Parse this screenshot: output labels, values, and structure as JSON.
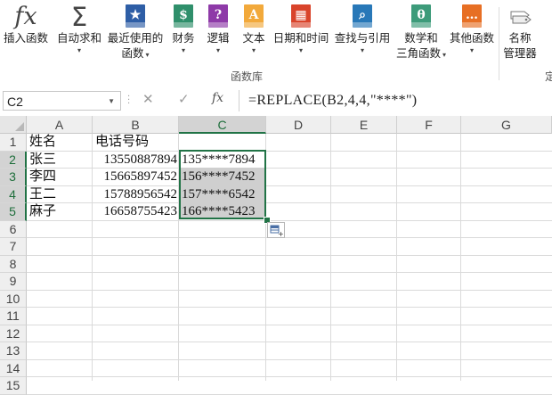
{
  "ribbon": {
    "buttons": [
      {
        "id": "insert-function",
        "label": "插入函数",
        "label2": "",
        "icon": "fx-icon",
        "color": "#444444",
        "glyph": "fx"
      },
      {
        "id": "autosum",
        "label": "自动求和",
        "label2": "",
        "icon": "sigma-icon",
        "color": "#444444",
        "glyph": "Σ"
      },
      {
        "id": "recently-used",
        "label": "最近使用的",
        "label2": "函数",
        "icon": "star-book-icon",
        "color": "#2e5ea6",
        "glyph": "★"
      },
      {
        "id": "financial",
        "label": "财务",
        "label2": "",
        "icon": "coins-book-icon",
        "color": "#2f8f6b",
        "glyph": "$"
      },
      {
        "id": "logical",
        "label": "逻辑",
        "label2": "",
        "icon": "question-book-icon",
        "color": "#8e3aa8",
        "glyph": "?"
      },
      {
        "id": "text",
        "label": "文本",
        "label2": "",
        "icon": "text-book-icon",
        "color": "#f2a93b",
        "glyph": "A"
      },
      {
        "id": "date-time",
        "label": "日期和时间",
        "label2": "",
        "icon": "calendar-book-icon",
        "color": "#d9442b",
        "glyph": "▦"
      },
      {
        "id": "lookup-reference",
        "label": "查找与引用",
        "label2": "",
        "icon": "search-book-icon",
        "color": "#2878b8",
        "glyph": "⌕"
      },
      {
        "id": "math-trig",
        "label": "数学和",
        "label2": "三角函数",
        "icon": "theta-book-icon",
        "color": "#3d9b7a",
        "glyph": "θ"
      },
      {
        "id": "more-functions",
        "label": "其他函数",
        "label2": "",
        "icon": "more-book-icon",
        "color": "#e76f24",
        "glyph": "…"
      },
      {
        "id": "name-manager",
        "label": "名称",
        "label2": "管理器",
        "icon": "name-tags-icon",
        "color": "#777777",
        "glyph": ""
      }
    ],
    "group_label": "函数库",
    "cut_label": "定"
  },
  "formula_bar": {
    "name_box": "C2",
    "cancel_icon": "✕",
    "enter_icon": "✓",
    "fx_label": "fx",
    "formula": "=REPLACE(B2,4,4,\"****\")"
  },
  "sheet": {
    "columns": [
      "A",
      "B",
      "C",
      "D",
      "E",
      "F",
      "G"
    ],
    "selected_column": "C",
    "rows": [
      "1",
      "2",
      "3",
      "4",
      "5",
      "6",
      "7",
      "8",
      "9",
      "10",
      "11",
      "12",
      "13",
      "14",
      "15"
    ],
    "selected_rows": [
      "2",
      "3",
      "4",
      "5"
    ],
    "cells": {
      "A1": "姓名",
      "B1": "电话号码",
      "A2": "张三",
      "B2": "13550887894",
      "C2": "135****7894",
      "A3": "李四",
      "B3": "15665897452",
      "C3": "156****7452",
      "A4": "王二",
      "B4": "15788956542",
      "C4": "157****6542",
      "A5": "麻子",
      "B5": "16658755423",
      "C5": "166****5423"
    },
    "accent_color": "#217346"
  }
}
